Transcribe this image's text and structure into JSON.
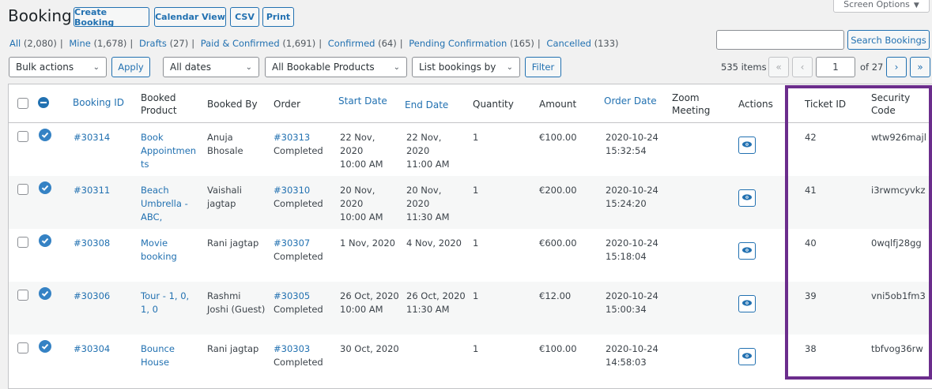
{
  "page": {
    "title": "Booking",
    "buttons": [
      "Create Booking",
      "Calendar View",
      "CSV",
      "Print"
    ],
    "screen_options": "Screen Options"
  },
  "filters": [
    {
      "label": "All",
      "count": "(2,080)"
    },
    {
      "label": "Mine",
      "count": "(1,678)"
    },
    {
      "label": "Drafts",
      "count": "(27)"
    },
    {
      "label": "Paid & Confirmed",
      "count": "(1,691)"
    },
    {
      "label": "Confirmed",
      "count": "(64)"
    },
    {
      "label": "Pending Confirmation",
      "count": "(165)"
    },
    {
      "label": "Cancelled",
      "count": "(133)"
    }
  ],
  "search": {
    "button": "Search Bookings",
    "value": ""
  },
  "toolbar": {
    "bulk_actions": "Bulk actions",
    "apply": "Apply",
    "dates": "All dates",
    "products": "All Bookable Products",
    "list_by": "List bookings by",
    "filter": "Filter"
  },
  "pagination": {
    "items": "535 items",
    "first": "«",
    "prev": "‹",
    "current": "1",
    "of": "of 27",
    "next": "›",
    "last": "»"
  },
  "table": {
    "headers": {
      "booking_id": "Booking ID",
      "booked_product": [
        "Booked",
        "Product"
      ],
      "booked_by": "Booked By",
      "order": "Order",
      "start_date": "Start Date",
      "end_date": "End Date",
      "quantity": "Quantity",
      "amount": "Amount",
      "order_date": "Order Date",
      "zoom": [
        "Zoom",
        "Meeting"
      ],
      "actions": "Actions",
      "ticket_id": "Ticket ID",
      "security_code": [
        "Security",
        "Code"
      ]
    },
    "rows": [
      {
        "id": "#30314",
        "product": [
          "Book",
          "Appointmen",
          "ts"
        ],
        "by": [
          "Anuja",
          "Bhosale"
        ],
        "order": "#30313",
        "order_status": "Completed",
        "start": [
          "22 Nov,",
          "2020",
          "10:00 AM"
        ],
        "end": [
          "22 Nov,",
          "2020",
          "11:00 AM"
        ],
        "qty": "1",
        "amount": "€100.00",
        "order_date": [
          "2020-10-24",
          "15:32:54"
        ],
        "ticket": "42",
        "code": "wtw926majl"
      },
      {
        "id": "#30311",
        "product": [
          "Beach",
          "Umbrella -",
          "ABC,"
        ],
        "by": [
          "Vaishali",
          "jagtap"
        ],
        "order": "#30310",
        "order_status": "Completed",
        "start": [
          "20 Nov,",
          "2020",
          "10:00 AM"
        ],
        "end": [
          "20 Nov,",
          "2020",
          "11:30 AM"
        ],
        "qty": "1",
        "amount": "€200.00",
        "order_date": [
          "2020-10-24",
          "15:24:20"
        ],
        "ticket": "41",
        "code": "i3rwmcyvkz"
      },
      {
        "id": "#30308",
        "product": [
          "Movie",
          "booking",
          ""
        ],
        "by": [
          "Rani jagtap",
          ""
        ],
        "order": "#30307",
        "order_status": "Completed",
        "start": [
          "1 Nov, 2020",
          "",
          ""
        ],
        "end": [
          "4 Nov, 2020",
          "",
          ""
        ],
        "qty": "1",
        "amount": "€600.00",
        "order_date": [
          "2020-10-24",
          "15:18:04"
        ],
        "ticket": "40",
        "code": "0wqlfj28gg"
      },
      {
        "id": "#30306",
        "product": [
          "Tour - 1, 0,",
          "1, 0",
          ""
        ],
        "by": [
          "Rashmi",
          "Joshi (Guest)"
        ],
        "order": "#30305",
        "order_status": "Completed",
        "start": [
          "26 Oct, 2020",
          "10:00 AM",
          ""
        ],
        "end": [
          "26 Oct, 2020",
          "11:30 AM",
          ""
        ],
        "qty": "1",
        "amount": "€12.00",
        "order_date": [
          "2020-10-24",
          "15:00:34"
        ],
        "ticket": "39",
        "code": "vni5ob1fm3"
      },
      {
        "id": "#30304",
        "product": [
          "Bounce",
          "House",
          ""
        ],
        "by": [
          "Rani jagtap",
          ""
        ],
        "order": "#30303",
        "order_status": "Completed",
        "start": [
          "30 Oct, 2020",
          "",
          ""
        ],
        "end": [
          "",
          "",
          ""
        ],
        "qty": "1",
        "amount": "€100.00",
        "order_date": [
          "2020-10-24",
          "14:58:03"
        ],
        "ticket": "38",
        "code": "tbfvog36rw"
      }
    ]
  },
  "colors": {
    "accent": "#2271b1",
    "highlight": "#6b2d8c",
    "status": "#3582c4"
  }
}
